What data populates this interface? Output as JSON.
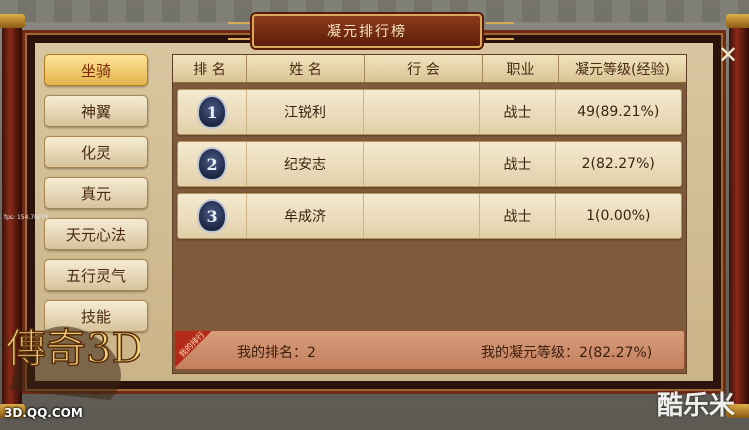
{
  "window": {
    "title": "凝元排行榜",
    "close_glyph": "✕"
  },
  "sidebar": {
    "items": [
      {
        "label": "坐骑",
        "active": true
      },
      {
        "label": "神翼",
        "active": false
      },
      {
        "label": "化灵",
        "active": false
      },
      {
        "label": "真元",
        "active": false
      },
      {
        "label": "天元心法",
        "active": false
      },
      {
        "label": "五行灵气",
        "active": false
      },
      {
        "label": "技能",
        "active": false
      }
    ]
  },
  "table": {
    "headers": [
      "排 名",
      "姓 名",
      "行 会",
      "职业",
      "凝元等级(经验)"
    ],
    "rows": [
      {
        "rank": "1",
        "name": "江锐利",
        "guild": "",
        "job": "战士",
        "level": "49(89.21%)"
      },
      {
        "rank": "2",
        "name": "纪安志",
        "guild": "",
        "job": "战士",
        "level": "2(82.27%)"
      },
      {
        "rank": "3",
        "name": "牟成济",
        "guild": "",
        "job": "战士",
        "level": "1(0.00%)"
      }
    ]
  },
  "footer": {
    "ribbon": "我的排行",
    "my_rank": "我的排名：2",
    "my_level": "我的凝元等级：2(82.27%)"
  },
  "overlay": {
    "logo_text": "3D.QQ.COM",
    "logo_name": "傳奇3D",
    "watermark": "酷乐米",
    "fps_text": "fps: 154.70FPS"
  },
  "colors": {
    "panel_frame": "#6d2a17",
    "parchment": "#d9c6a0",
    "active_tab": "#e3b54c",
    "footer_bar": "#c27f5e",
    "rank_badge": "#1d2744"
  }
}
